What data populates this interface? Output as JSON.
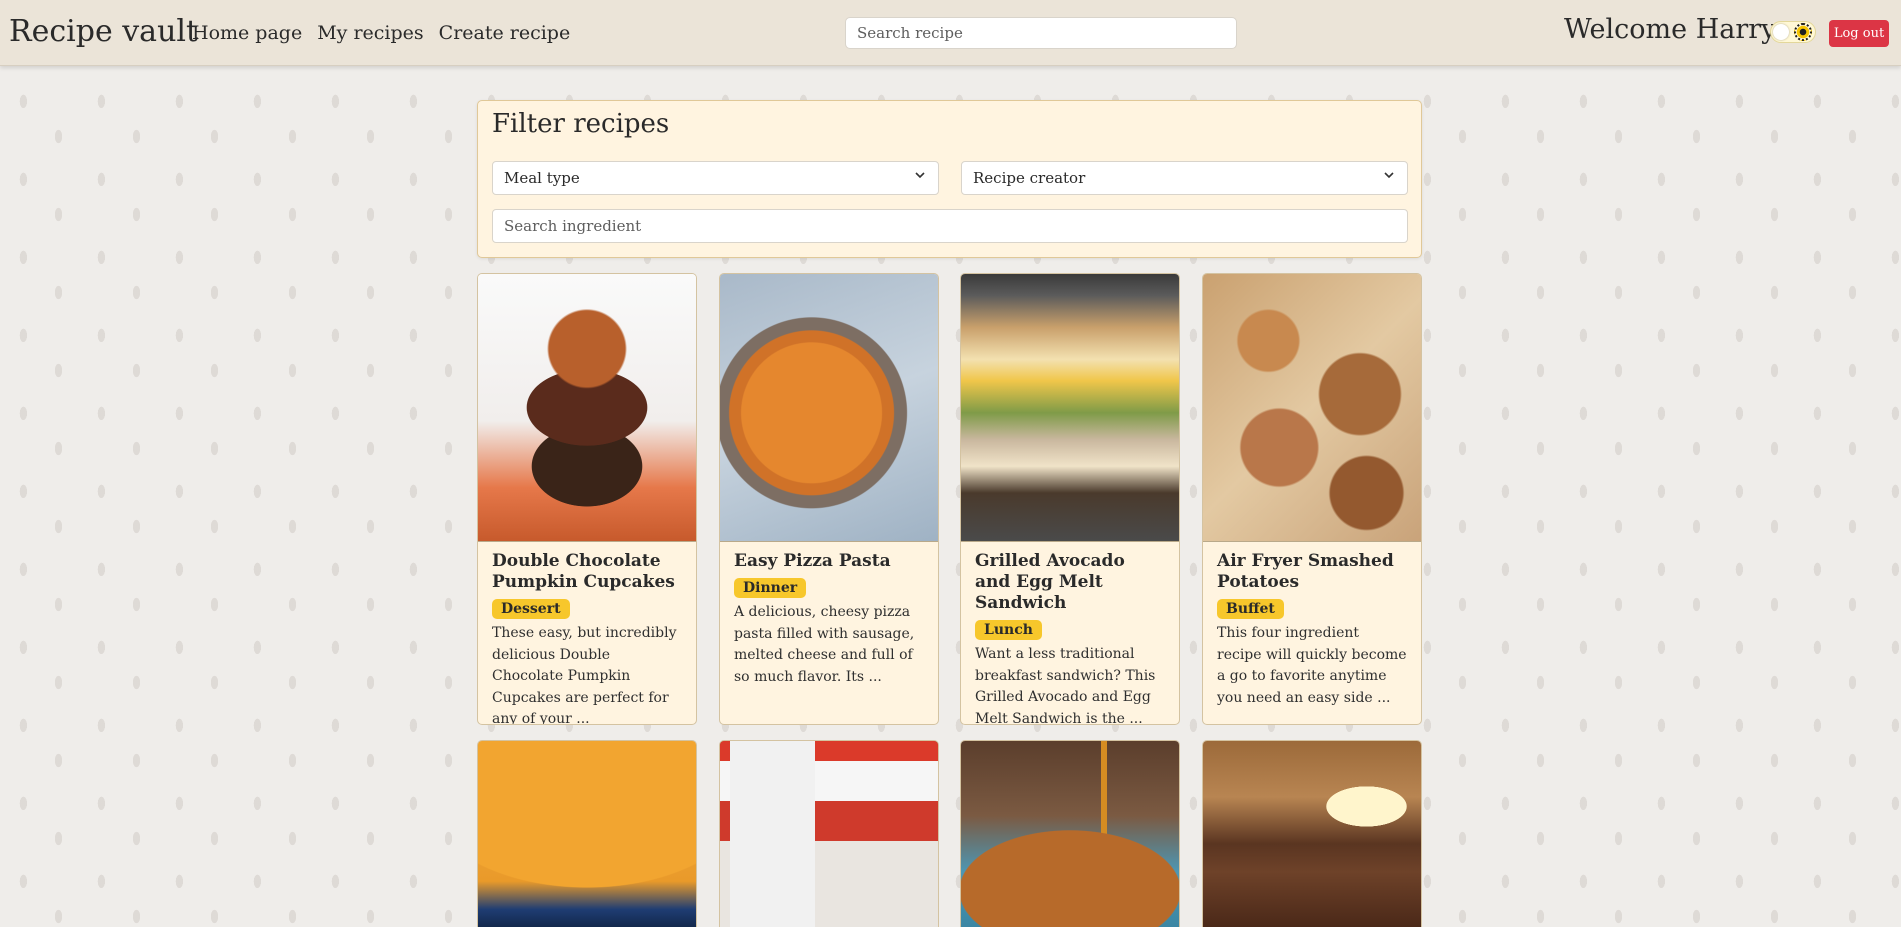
{
  "nav": {
    "brand": "Recipe vault",
    "links": [
      "Home page",
      "My recipes",
      "Create recipe"
    ],
    "search_placeholder": "Search recipe",
    "welcome": "Welcome Harry",
    "logout_label": "Log out"
  },
  "filter": {
    "title": "Filter recipes",
    "meal_type_label": "Meal type",
    "creator_label": "Recipe creator",
    "ingredient_placeholder": "Search ingredient"
  },
  "colors": {
    "navbar_bg": "#ebe4d8",
    "panel_bg": "#fff4e0",
    "badge": "#f7c72b",
    "logout": "#dc3545"
  },
  "recipes": [
    {
      "title": "Double Chocolate Pumpkin Cupcakes",
      "meal_type": "Dessert",
      "description": "These easy, but incredibly delicious Double Chocolate Pumpkin Cupcakes are perfect for any of your ..."
    },
    {
      "title": "Easy Pizza Pasta",
      "meal_type": "Dinner",
      "description": "A delicious, cheesy pizza pasta filled with sausage, melted cheese and full of so much flavor. Its ..."
    },
    {
      "title": "Grilled Avocado and Egg Melt Sandwich",
      "meal_type": "Lunch",
      "description": "Want a less traditional breakfast sandwich? This Grilled Avocado and Egg Melt Sandwich is the ..."
    },
    {
      "title": "Air Fryer Smashed Potatoes",
      "meal_type": "Buffet",
      "description": "This four ingredient recipe will quickly become a go to favorite anytime you need an easy side ..."
    }
  ]
}
